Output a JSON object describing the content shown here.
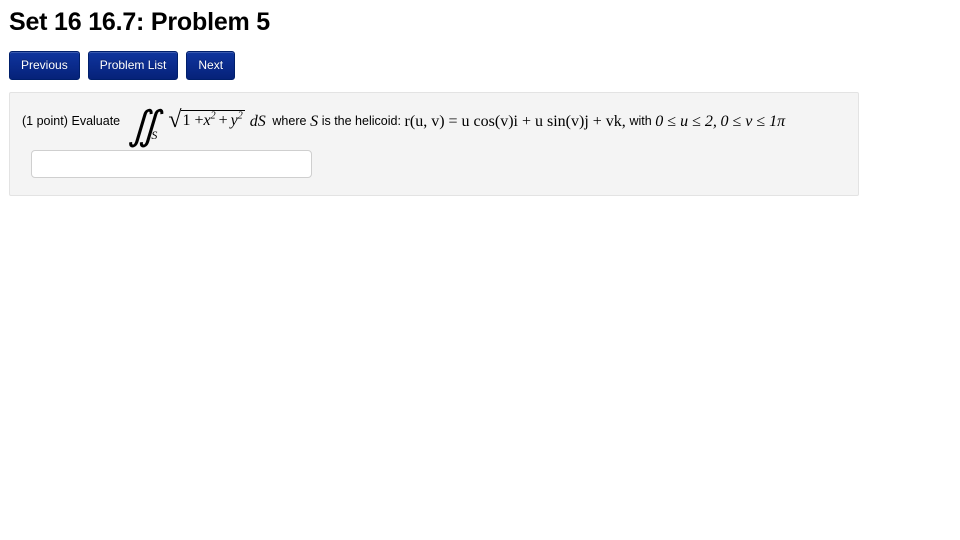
{
  "page": {
    "title": "Set 16 16.7: Problem 5"
  },
  "nav": {
    "buttons": [
      {
        "label": "Previous",
        "name": "previous-button"
      },
      {
        "label": "Problem List",
        "name": "problem-list-button"
      },
      {
        "label": "Next",
        "name": "next-button"
      }
    ]
  },
  "problem": {
    "points_label": "(1 point)",
    "verb": "Evaluate",
    "integral": {
      "symbol": "∬",
      "subscript": "S",
      "integrand_open": "1 +",
      "term_x": "x",
      "term_x_exp": "2",
      "plus": "+",
      "term_y": "y",
      "term_y_exp": "2",
      "differential": "dS"
    },
    "where_text": "where",
    "surface_symbol": "S",
    "is_the_helicoid_text": "is the helicoid:",
    "vector_function": "r(u, v) = u cos(v)i + u sin(v)j + vk,",
    "with_text": "with",
    "domain_u": "0 ≤ u ≤ 2,",
    "domain_v": "0 ≤ v ≤ 1π",
    "full_text_plain": "(1 point) Evaluate ∬_S √(1 + x² + y²) dS where S is the helicoid: r(u,v) = u cos(v)i + u sin(v)j + vk, with 0 ≤ u ≤ 2, 0 ≤ v ≤ 1π"
  },
  "answer": {
    "value": "",
    "placeholder": ""
  },
  "colors": {
    "button_blue": "#0b2c8e",
    "button_border": "#001f6b",
    "panel_bg": "#f4f4f4",
    "panel_border": "#e3e3e3",
    "input_border": "#cfcfcf",
    "text": "#000000"
  }
}
